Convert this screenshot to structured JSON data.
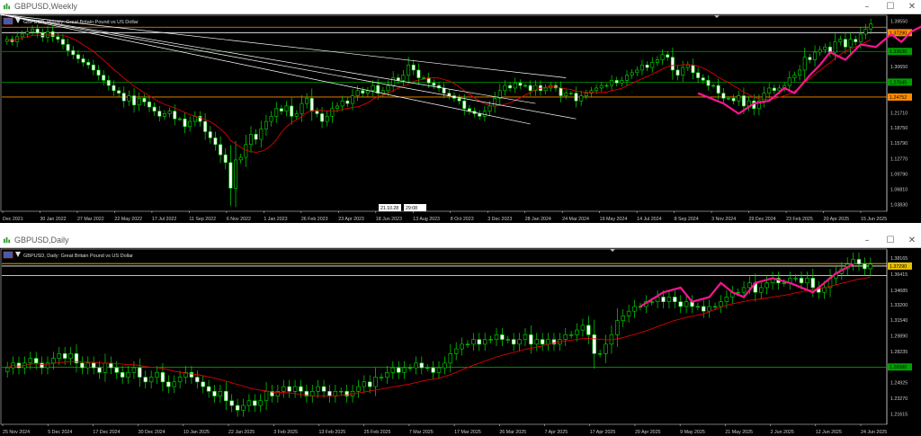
{
  "chart_data": [
    {
      "type": "candlestick",
      "window_title": "GBPUSD,Weekly",
      "caption": "GBPUSD, Weekly: Great Britain Pound vs US Dollar",
      "price_levels": [
        "1.39550",
        "1.37290",
        "1.33630",
        "1.30650",
        "1.27645",
        "1.24752",
        "1.21710",
        "1.18750",
        "1.15790",
        "1.12770",
        "1.09790",
        "1.06810",
        "1.03830"
      ],
      "price_min": 1.025,
      "price_max": 1.405,
      "time_labels": [
        "Dec 2021",
        "30 Jan 2022",
        "27 Mar 2022",
        "22 May 2022",
        "17 Jul 2022",
        "11 Sep 2022",
        "6 Nov 2022",
        "1 Jan 2023",
        "26 Feb 2023",
        "23 Apr 2023",
        "18 Jun 2023",
        "13 Aug 2023",
        "8 Oct 2023",
        "3 Dec 2023",
        "28 Jan 2024",
        "24 Mar 2024",
        "19 May 2024",
        "14 Jul 2024",
        "8 Sep 2024",
        "3 Nov 2024",
        "29 Dec 2024",
        "23 Feb 2025",
        "20 Apr 2025",
        "15 Jun 2025"
      ],
      "time_badges": [
        "21.10.28",
        "29:08"
      ],
      "horizontal_lines": [
        {
          "price": 1.3835,
          "color": "#ff8c00"
        },
        {
          "price": 1.3729,
          "color": "#ffffff"
        },
        {
          "price": 1.3363,
          "color": "#00a000"
        },
        {
          "price": 1.2765,
          "color": "#00a000"
        },
        {
          "price": 1.2475,
          "color": "#ff8c00"
        }
      ],
      "price_badges": [
        {
          "text": "1.37290",
          "price": 1.3729,
          "bg": "#ff8c00"
        },
        {
          "text": "1.33630",
          "price": 1.3363,
          "bg": "#00a000"
        },
        {
          "text": "1.27645",
          "price": 1.2765,
          "bg": "#00a000"
        },
        {
          "text": "1.24752",
          "price": 1.2475,
          "bg": "#ff8c00"
        }
      ],
      "moving_average_color": "#e00000",
      "candles_approx": [
        1.36,
        1.355,
        1.365,
        1.37,
        1.375,
        1.38,
        1.372,
        1.364,
        1.375,
        1.365,
        1.36,
        1.35,
        1.338,
        1.33,
        1.322,
        1.315,
        1.31,
        1.3,
        1.29,
        1.28,
        1.27,
        1.26,
        1.255,
        1.24,
        1.25,
        1.232,
        1.245,
        1.238,
        1.228,
        1.22,
        1.21,
        1.215,
        1.22,
        1.205,
        1.205,
        1.19,
        1.2,
        1.21,
        1.2,
        1.18,
        1.168,
        1.155,
        1.135,
        1.12,
        1.07,
        1.125,
        1.13,
        1.155,
        1.175,
        1.165,
        1.185,
        1.2,
        1.21,
        1.225,
        1.22,
        1.23,
        1.21,
        1.215,
        1.235,
        1.245,
        1.22,
        1.215,
        1.2,
        1.21,
        1.225,
        1.23,
        1.24,
        1.235,
        1.25,
        1.26,
        1.255,
        1.26,
        1.27,
        1.255,
        1.26,
        1.27,
        1.285,
        1.28,
        1.29,
        1.31,
        1.3,
        1.285,
        1.285,
        1.275,
        1.27,
        1.265,
        1.255,
        1.25,
        1.245,
        1.24,
        1.225,
        1.22,
        1.215,
        1.21,
        1.22,
        1.23,
        1.245,
        1.26,
        1.27,
        1.265,
        1.275,
        1.27,
        1.27,
        1.26,
        1.27,
        1.26,
        1.265,
        1.27,
        1.265,
        1.25,
        1.255,
        1.255,
        1.24,
        1.25,
        1.255,
        1.26,
        1.265,
        1.27,
        1.27,
        1.28,
        1.275,
        1.28,
        1.29,
        1.295,
        1.3,
        1.31,
        1.305,
        1.315,
        1.32,
        1.33,
        1.325,
        1.3,
        1.29,
        1.305,
        1.31,
        1.295,
        1.285,
        1.28,
        1.27,
        1.27,
        1.255,
        1.245,
        1.245,
        1.24,
        1.25,
        1.23,
        1.24,
        1.225,
        1.24,
        1.255,
        1.265,
        1.26,
        1.265,
        1.27,
        1.285,
        1.29,
        1.3,
        1.325,
        1.32,
        1.335,
        1.34,
        1.345,
        1.335,
        1.355,
        1.36,
        1.345,
        1.36,
        1.355,
        1.37,
        1.38,
        1.39
      ]
    },
    {
      "type": "candlestick",
      "window_title": "GBPUSD,Daily",
      "caption": "GBPUSD, Daily: Great Britain Pound vs US Dollar",
      "price_levels": [
        "1.38165",
        "1.37290",
        "1.36415",
        "1.34685",
        "1.33200",
        "1.31540",
        "1.29890",
        "1.28235",
        "1.26580",
        "1.24925",
        "1.23270",
        "1.21615"
      ],
      "price_min": 1.205,
      "price_max": 1.39,
      "time_labels": [
        "25 Nov 2024",
        "5 Dec 2024",
        "17 Dec 2024",
        "30 Dec 2024",
        "10 Jan 2025",
        "22 Jan 2025",
        "3 Feb 2025",
        "13 Feb 2025",
        "25 Feb 2025",
        "7 Mar 2025",
        "17 Mar 2025",
        "26 Mar 2025",
        "7 Apr 2025",
        "17 Apr 2025",
        "29 Apr 2025",
        "9 May 2025",
        "21 May 2025",
        "2 Jun 2025",
        "12 Jun 2025",
        "24 Jun 2025"
      ],
      "horizontal_lines": [
        {
          "price": 1.3755,
          "color": "#e8c000"
        },
        {
          "price": 1.3729,
          "color": "#ffffff"
        },
        {
          "price": 1.3628,
          "color": "#ffffff"
        },
        {
          "price": 1.2655,
          "color": "#00a000"
        }
      ],
      "price_badges": [
        {
          "text": "1.37290",
          "price": 1.3729,
          "bg": "#e8c000"
        },
        {
          "text": "1.26580",
          "price": 1.2658,
          "bg": "#00a000"
        }
      ],
      "moving_average_color": "#e00000",
      "candles_approx": [
        1.265,
        1.27,
        1.265,
        1.27,
        1.275,
        1.27,
        1.265,
        1.27,
        1.275,
        1.28,
        1.275,
        1.28,
        1.27,
        1.265,
        1.27,
        1.265,
        1.26,
        1.27,
        1.265,
        1.26,
        1.255,
        1.26,
        1.265,
        1.255,
        1.25,
        1.255,
        1.26,
        1.25,
        1.245,
        1.25,
        1.255,
        1.26,
        1.255,
        1.25,
        1.245,
        1.24,
        1.235,
        1.24,
        1.23,
        1.225,
        1.22,
        1.225,
        1.23,
        1.225,
        1.23,
        1.24,
        1.235,
        1.24,
        1.245,
        1.24,
        1.245,
        1.24,
        1.235,
        1.24,
        1.245,
        1.24,
        1.235,
        1.24,
        1.24,
        1.235,
        1.24,
        1.245,
        1.25,
        1.245,
        1.255,
        1.255,
        1.26,
        1.265,
        1.26,
        1.265,
        1.265,
        1.27,
        1.265,
        1.265,
        1.26,
        1.265,
        1.27,
        1.28,
        1.285,
        1.29,
        1.29,
        1.295,
        1.29,
        1.295,
        1.295,
        1.3,
        1.295,
        1.295,
        1.29,
        1.295,
        1.3,
        1.29,
        1.295,
        1.29,
        1.295,
        1.29,
        1.295,
        1.3,
        1.3,
        1.305,
        1.31,
        1.3,
        1.28,
        1.28,
        1.29,
        1.3,
        1.315,
        1.32,
        1.325,
        1.33,
        1.33,
        1.335,
        1.335,
        1.34,
        1.335,
        1.34,
        1.335,
        1.33,
        1.335,
        1.33,
        1.33,
        1.325,
        1.33,
        1.33,
        1.335,
        1.34,
        1.345,
        1.345,
        1.35,
        1.355,
        1.345,
        1.35,
        1.355,
        1.36,
        1.355,
        1.355,
        1.36,
        1.36,
        1.355,
        1.36,
        1.35,
        1.345,
        1.35,
        1.36,
        1.365,
        1.37,
        1.375,
        1.38,
        1.375,
        1.37,
        1.375
      ]
    }
  ]
}
